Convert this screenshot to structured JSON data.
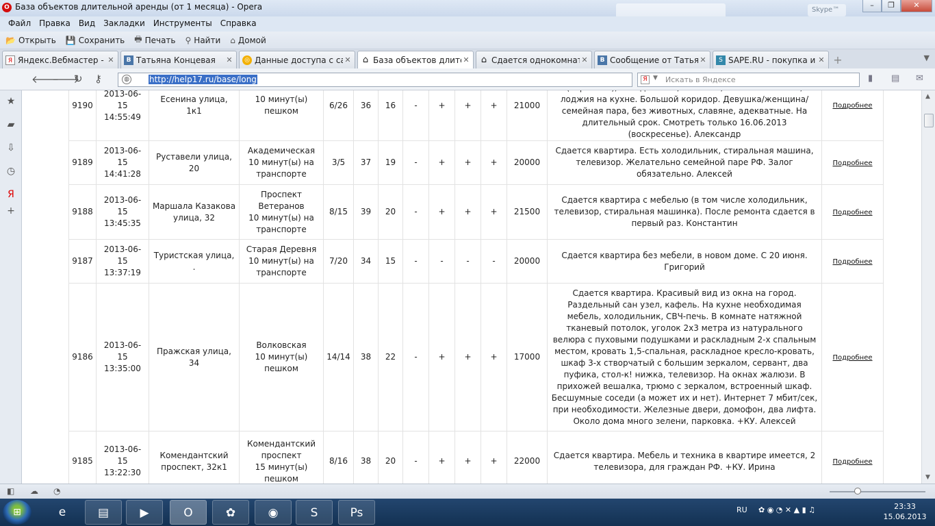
{
  "window": {
    "title": "База объектов длительной аренды (от 1 месяца) - Opera",
    "skype_label": "Skype™"
  },
  "menu": [
    "Файл",
    "Правка",
    "Вид",
    "Закладки",
    "Инструменты",
    "Справка"
  ],
  "toolbar": [
    {
      "icon": "folder-icon",
      "label": "Открыть"
    },
    {
      "icon": "save-icon",
      "label": "Сохранить"
    },
    {
      "icon": "print-icon",
      "label": "Печать"
    },
    {
      "icon": "search-icon",
      "label": "Найти"
    },
    {
      "icon": "home-icon",
      "label": "Домой"
    }
  ],
  "tabs": [
    {
      "icon": "yandex-icon",
      "label": "Яндекс.Вебмастер - М..."
    },
    {
      "icon": "vk-icon",
      "label": "Татьяна Концевая"
    },
    {
      "icon": "globe-icon",
      "label": "Данные доступа с сай..."
    },
    {
      "icon": "house-icon",
      "label": "База объектов длител...",
      "active": true
    },
    {
      "icon": "house-icon",
      "label": "Сдается однокомнатн..."
    },
    {
      "icon": "vk-icon",
      "label": "Сообщение от Татьян..."
    },
    {
      "icon": "sape-icon",
      "label": "SAPE.RU - покупка и п..."
    }
  ],
  "address": {
    "url": "http://help17.ru/base/long",
    "search_placeholder": "Искать в Яндексе"
  },
  "listings": [
    {
      "id": "9190",
      "date": "2013-06-15",
      "time": "14:55:49",
      "address": "Есенина улица, 1к1",
      "metro": [
        "",
        "10 минут(ы)",
        "пешком"
      ],
      "floor": "6/26",
      "area": "36",
      "living": "16",
      "f1": "-",
      "f2": "+",
      "f3": "+",
      "f4": "+",
      "price": "21000",
      "desc": "Интернет, коридор-шкаф купе, кухня (новая), плитка (керамика), холодильник, вытяжка, стол стеклянный, лоджия на кухне. Большой коридор. Девушка/женщина/семейная пара, без животных, славяне, адекватные. На длительный срок. Смотреть только 16.06.2013 (воскресенье). Александр"
    },
    {
      "id": "9189",
      "date": "2013-06-15",
      "time": "14:41:28",
      "address": "Руставели улица, 20",
      "metro": [
        "Академическая",
        "10 минут(ы) на",
        "транспорте"
      ],
      "floor": "3/5",
      "area": "37",
      "living": "19",
      "f1": "-",
      "f2": "+",
      "f3": "+",
      "f4": "+",
      "price": "20000",
      "desc": "Сдается квартира. Есть холодильник, стиральная машина, телевизор. Желательно семейной паре РФ. Залог обязательно. Алексей"
    },
    {
      "id": "9188",
      "date": "2013-06-15",
      "time": "13:45:35",
      "address": "Маршала Казакова улица, 32",
      "metro": [
        "Проспект Ветеранов",
        "10 минут(ы) на",
        "транспорте"
      ],
      "floor": "8/15",
      "area": "39",
      "living": "20",
      "f1": "-",
      "f2": "+",
      "f3": "+",
      "f4": "+",
      "price": "21500",
      "desc": "Сдается квартира с мебелью (в том числе холодильник, телевизор, стиральная машинка). После ремонта сдается в первый раз. Константин"
    },
    {
      "id": "9187",
      "date": "2013-06-15",
      "time": "13:37:19",
      "address": "Туристская улица, .",
      "metro": [
        "Старая Деревня",
        "10 минут(ы) на",
        "транспорте"
      ],
      "floor": "7/20",
      "area": "34",
      "living": "15",
      "f1": "-",
      "f2": "-",
      "f3": "-",
      "f4": "-",
      "price": "20000",
      "desc": "Сдается квартира без мебели, в новом доме. С 20 июня. Григорий"
    },
    {
      "id": "9186",
      "date": "2013-06-15",
      "time": "13:35:00",
      "address": "Пражская улица, 34",
      "metro": [
        "Волковская",
        "10 минут(ы)",
        "пешком"
      ],
      "floor": "14/14",
      "area": "38",
      "living": "22",
      "f1": "-",
      "f2": "+",
      "f3": "+",
      "f4": "+",
      "price": "17000",
      "desc": "Сдается квартира. Красивый вид из окна на город. Раздельный сан узел, кафель. На кухне необходимая мебель, холодильник, СВЧ-печь. В комнате натяжной тканевый потолок, уголок 2х3 метра из натурального велюра с пуховыми подушками и раскладным 2-х спальным местом, кровать 1,5-спальная, раскладное кресло-кровать, шкаф 3-х створчатый с большим зеркалом, сервант, два пуфика, стол-к! нижка, телевизор. На окнах жалюзи. В прихожей вешалка, трюмо с зеркалом, встроенный шкаф. Бесшумные соседи (а может их и нет). Интернет 7 мбит/сек, при необходимости. Железные двери, домофон, два лифта. Около дома много зелени, парковка. +КУ. Алексей"
    },
    {
      "id": "9185",
      "date": "2013-06-15",
      "time": "13:22:30",
      "address": "Комендантский проспект, 32к1",
      "metro": [
        "Комендантский проспект",
        "15 минут(ы)",
        "пешком"
      ],
      "floor": "8/16",
      "area": "38",
      "living": "20",
      "f1": "-",
      "f2": "+",
      "f3": "+",
      "f4": "+",
      "price": "22000",
      "desc": "Сдается квартира. Мебель и техника в квартире имеется, 2 телевизора, для граждан РФ. +КУ. Ирина"
    }
  ],
  "more_label": "Подробнее",
  "tray": {
    "lang": "RU",
    "time": "23:33",
    "date": "15.06.2013"
  }
}
